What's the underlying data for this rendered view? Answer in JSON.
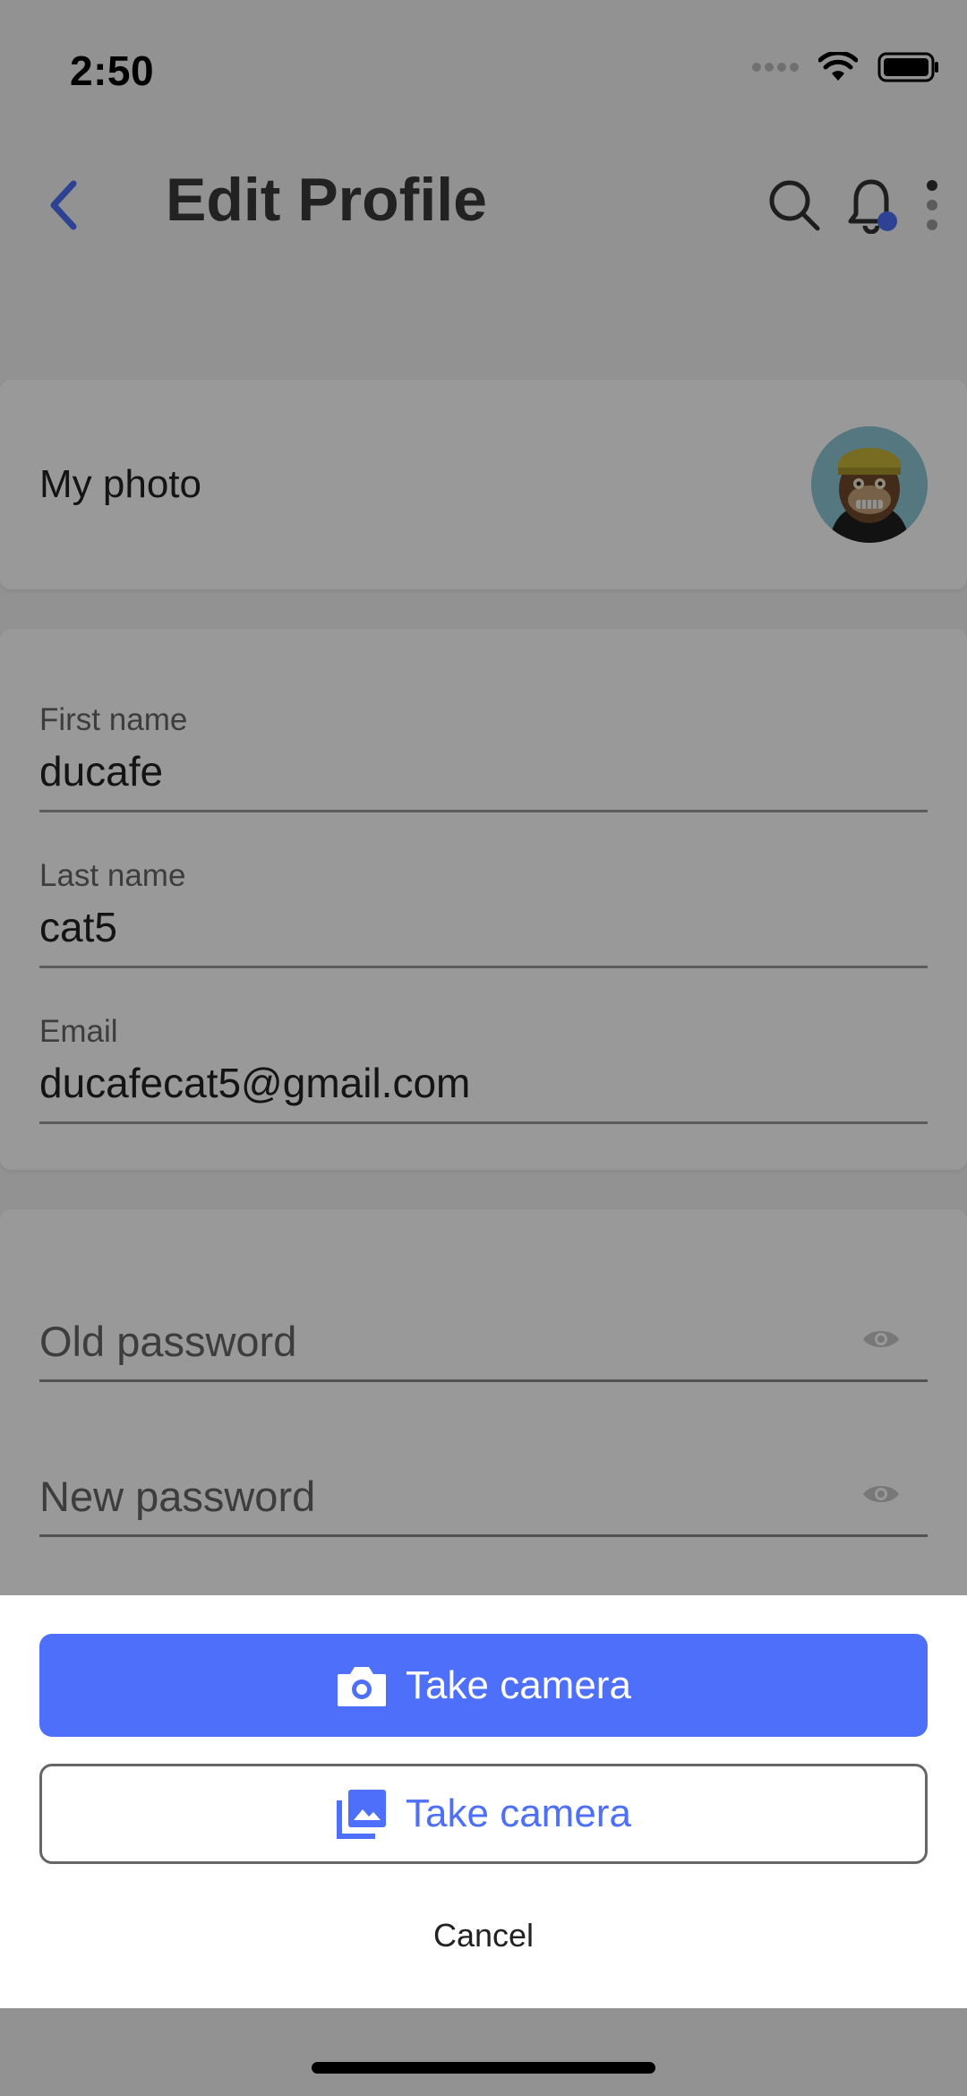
{
  "status_bar": {
    "time": "2:50"
  },
  "header": {
    "title": "Edit Profile"
  },
  "photo_card": {
    "label": "My photo"
  },
  "profile_fields": [
    {
      "label": "First name",
      "value": "ducafe"
    },
    {
      "label": "Last name",
      "value": "cat5"
    },
    {
      "label": "Email",
      "value": "ducafecat5@gmail.com"
    }
  ],
  "password_fields": [
    {
      "placeholder": "Old password"
    },
    {
      "placeholder": "New password"
    }
  ],
  "action_sheet": {
    "camera_label": "Take camera",
    "gallery_label": "Take camera",
    "cancel_label": "Cancel"
  },
  "colors": {
    "accent": "#4d6ffa",
    "overlay": "rgba(0,0,0,0.4)"
  },
  "icons": {
    "back": "chevron-left-icon",
    "search": "search-icon",
    "notifications": "bell-icon",
    "more": "more-vertical-icon",
    "camera": "camera-icon",
    "gallery": "photo-library-icon",
    "visibility": "eye-icon"
  }
}
